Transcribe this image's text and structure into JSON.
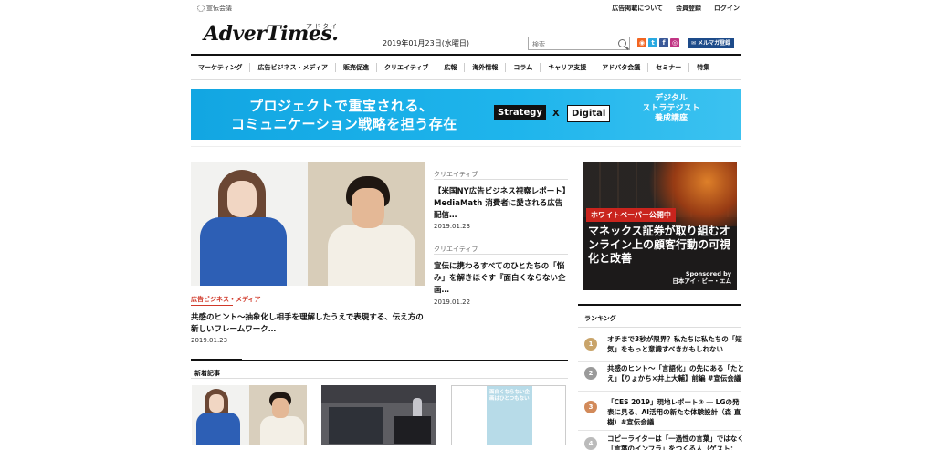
{
  "topbar": {
    "brand": "宣伝会議",
    "links": [
      "広告掲載について",
      "会員登録",
      "ログイン"
    ]
  },
  "header": {
    "logo": "AdverTimes.",
    "logo_kana": "アドタイ",
    "date": "2019年01月23日(水曜日)",
    "search_placeholder": "検索",
    "mailmag": "✉ メルマガ登録",
    "social": [
      {
        "name": "rss-icon",
        "color": "#f26522",
        "glyph": "◉"
      },
      {
        "name": "twitter-icon",
        "color": "#29a9e1",
        "glyph": "t"
      },
      {
        "name": "facebook-icon",
        "color": "#3b5998",
        "glyph": "f"
      },
      {
        "name": "instagram-icon",
        "color": "#c13584",
        "glyph": "◎"
      }
    ]
  },
  "nav": [
    "マーケティング",
    "広告ビジネス・メディア",
    "販売促進",
    "クリエイティブ",
    "広報",
    "海外情報",
    "コラム",
    "キャリア支援",
    "アドバタ会議",
    "セミナー",
    "特集"
  ],
  "banner": {
    "line1": "プロジェクトで重宝される、",
    "line2": "コミュニケーション戦略を担う存在",
    "box1": "Strategy",
    "x": "X",
    "box2": "Digital",
    "side1": "デジタル",
    "side2": "ストラテジスト",
    "side3": "養成講座"
  },
  "hero": {
    "category": "広告ビジネス・メディア",
    "title": "共感のヒント〜抽象化し相手を理解したうえで表現する、伝え方の新しいフレームワーク…",
    "date": "2019.01.23"
  },
  "articles": [
    {
      "category": "クリエイティブ",
      "title": "【米国NY広告ビジネス視察レポート】MediaMath 消費者に愛される広告配信…",
      "date": "2019.01.23"
    },
    {
      "category": "クリエイティブ",
      "title": "宣伝に携わるすべてのひとたちの「悩み」を解きほぐす『面白くならない企画…",
      "date": "2019.01.22"
    }
  ],
  "ad": {
    "tag": "ホワイトペーパー公開中",
    "copy": "マネックス証券が取り組むオンライン上の顧客行動の可視化と改善",
    "sponsor1": "Sponsored by",
    "sponsor2": "日本アイ・ビー・エム"
  },
  "ranking": {
    "heading": "ランキング",
    "items": [
      {
        "n": "1",
        "color": "#c9a46a",
        "text": "オチまで3秒が限界？私たちは私たちの「短気」をもっと意識すべきかもしれない"
      },
      {
        "n": "2",
        "color": "#9a9a9a",
        "text": "共感のヒント〜「言語化」の先にある「たとえ」【りょかち×井上大輔】前編 #宣伝会議"
      },
      {
        "n": "3",
        "color": "#d28a5a",
        "text": "「CES 2019」現地レポート③ ― LGの発表に見る、AI活用の新たな体験設計（森 直樹）#宣伝会議"
      },
      {
        "n": "4",
        "color": "#bbbbbb",
        "text": "コピーライターは「一過性の言葉」ではなく「言葉のインフラ」をつくる人（ゲスト："
      }
    ]
  },
  "newest": {
    "heading": "新着記事",
    "thumb3_text": "面白くならない企画はひとつもない"
  }
}
